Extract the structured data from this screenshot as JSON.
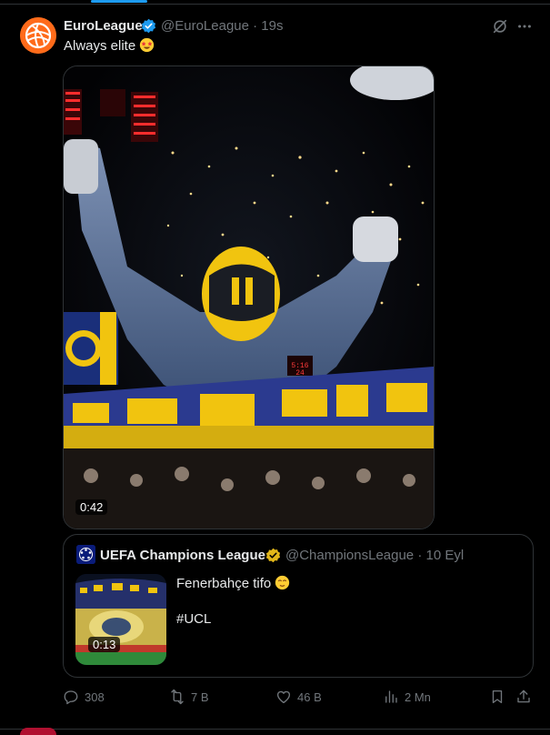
{
  "tweet": {
    "author_name": "EuroLeague",
    "author_handle": "@EuroLeague · 19s",
    "text": "Always elite",
    "text_emoji": "star-struck-emoji",
    "media_duration": "0:42",
    "scoreboard_text": "5:16 24"
  },
  "quote": {
    "author_name": "UEFA Champions League",
    "author_handle": "@ChampionsLeague · 10 Eyl",
    "text_line1": "Fenerbahçe tifo",
    "text_line1_emoji": "relieved-face-emoji",
    "text_line2": "#UCL",
    "thumb_duration": "0:13"
  },
  "actions": {
    "replies": "308",
    "reposts": "7 B",
    "likes": "46 B",
    "views": "2 Mn"
  },
  "colors": {
    "background": "#000000",
    "border": "#2f3336",
    "muted_text": "#71767b",
    "primary_text": "#e7e9ea",
    "verified_blue": "#1d9bf0",
    "verified_gold": "#e2b719",
    "euroleague_orange": "#ff6b1a"
  }
}
